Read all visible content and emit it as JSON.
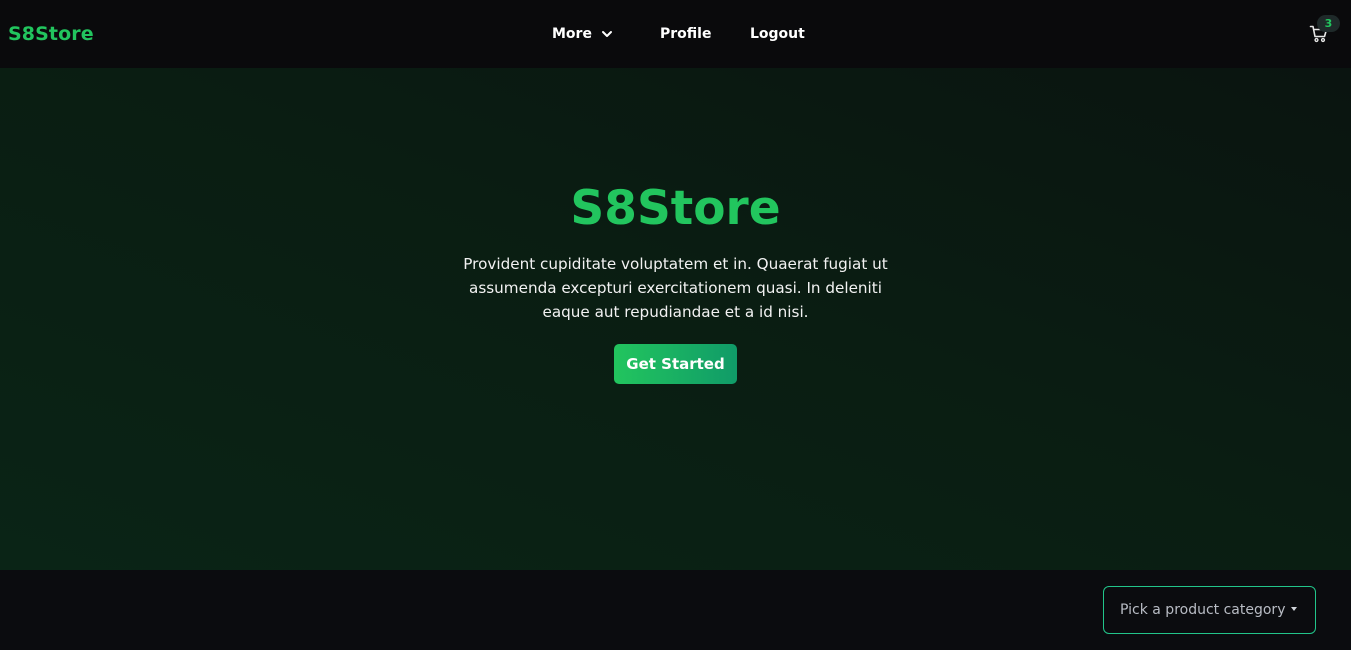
{
  "brand": "S8Store",
  "nav": {
    "more_label": "More",
    "profile_label": "Profile",
    "logout_label": "Logout"
  },
  "cart": {
    "count": "3",
    "icon": "shopping-cart-icon"
  },
  "hero": {
    "title": "S8Store",
    "text": "Provident cupiditate voluptatem et in. Quaerat fugiat ut assumenda excepturi exercitationem quasi. In deleniti eaque aut repudiandae et a id nisi.",
    "cta_label": "Get Started"
  },
  "category_select": {
    "placeholder": "Pick a product category"
  },
  "colors": {
    "accent": "#22c55e",
    "navbar_bg": "#0a0a0c",
    "page_bg": "#0b0c0f"
  }
}
